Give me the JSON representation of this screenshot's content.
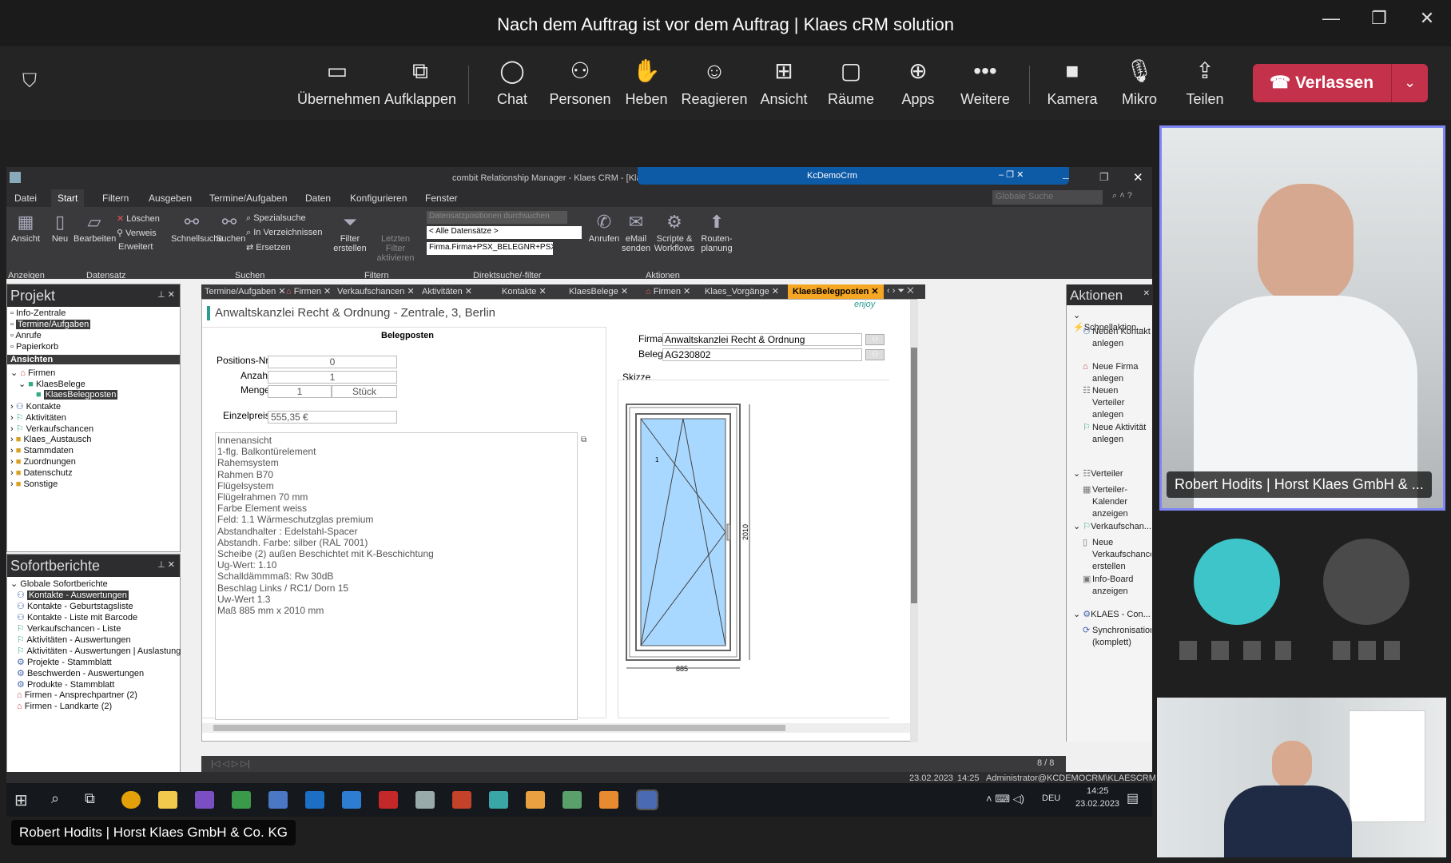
{
  "window": {
    "title": "Nach dem Auftrag ist vor dem Auftrag | Klaes cRM solution",
    "minimize": "—",
    "maximize": "❐",
    "close": "✕"
  },
  "toolbar": {
    "items": [
      {
        "label": "Übernehmen",
        "icon": "share-screen-icon"
      },
      {
        "label": "Aufklappen",
        "icon": "pop-out-icon"
      },
      {
        "label": "Chat",
        "icon": "chat-icon"
      },
      {
        "label": "Personen",
        "icon": "people-icon"
      },
      {
        "label": "Heben",
        "icon": "raise-hand-icon"
      },
      {
        "label": "Reagieren",
        "icon": "react-icon"
      },
      {
        "label": "Ansicht",
        "icon": "view-icon"
      },
      {
        "label": "Räume",
        "icon": "rooms-icon"
      },
      {
        "label": "Apps",
        "icon": "apps-icon"
      },
      {
        "label": "Weitere",
        "icon": "more-icon"
      },
      {
        "label": "Kamera",
        "icon": "camera-icon"
      },
      {
        "label": "Mikro",
        "icon": "mic-icon"
      },
      {
        "label": "Teilen",
        "icon": "share-icon"
      }
    ],
    "leave": "Verlassen"
  },
  "crm": {
    "title": "combit Relationship Manager - Klaes CRM - [Klae",
    "overlay_title": "KcDemoCrm",
    "menu": [
      "Datei",
      "Start",
      "Filtern",
      "Ausgeben",
      "Termine/Aufgaben",
      "Daten",
      "Konfigurieren",
      "Fenster"
    ],
    "search_placeholder": "Globale Suche",
    "ribbon": {
      "ansicht": "Ansicht",
      "neu": "Neu",
      "bearbeiten": "Bearbeiten",
      "loeschen": "Löschen",
      "verweis": "Verweis",
      "erweitert": "Erweitert",
      "schnellsuche": "Schnellsuche",
      "suchen": "Suchen",
      "spezialsuche": "Spezialsuche",
      "in_verzeichnissen": "In Verzeichnissen",
      "ersetzen": "Ersetzen",
      "filter_erstellen": "Filter erstellen",
      "letzten_filter": "Letzten Filter aktivieren",
      "direkt_placeholder": "Datensatzpositionen durchsuchen",
      "alle_datensaetze": "< Alle Datensätze >",
      "firma_field": "Firma.Firma+PSX_BELEGNR+PSX_I",
      "anrufen": "Anrufen",
      "email": "eMail senden",
      "scripte": "Scripte & Workflows",
      "routen": "Routen- planung",
      "groups": [
        "Anzeigen",
        "Datensatz",
        "Suchen",
        "Filtern",
        "Direktsuche/-filter",
        "Aktionen"
      ]
    },
    "projekt": {
      "header": "Projekt",
      "items": [
        "Info-Zentrale",
        "Termine/Aufgaben",
        "Anrufe",
        "Papierkorb"
      ],
      "ansichten": "Ansichten",
      "tree": [
        "Firmen",
        "KlaesBelege",
        "KlaesBelegposten",
        "Kontakte",
        "Aktivitäten",
        "Verkaufschancen",
        "Klaes_Austausch",
        "Stammdaten",
        "Zuordnungen",
        "Datenschutz",
        "Sonstige"
      ]
    },
    "sofort": {
      "header": "Sofortberichte",
      "root": "Globale Sofortberichte",
      "items": [
        "Kontakte - Auswertungen",
        "Kontakte - Geburtstagsliste",
        "Kontakte - Liste mit Barcode",
        "Verkaufschancen - Liste",
        "Aktivitäten - Auswertungen",
        "Aktivitäten - Auswertungen | Auslastung",
        "Projekte - Stammblatt",
        "Beschwerden - Auswertungen",
        "Produkte - Stammblatt",
        "Firmen - Ansprechpartner (2)",
        "Firmen - Landkarte (2)"
      ]
    },
    "tabs": [
      "Termine/Aufgaben",
      "Firmen",
      "Verkaufschancen",
      "Aktivitäten",
      "Kontakte",
      "KlaesBelege",
      "Firmen",
      "Klaes_Vorgänge",
      "KlaesBelegposten"
    ],
    "form": {
      "header": "Anwaltskanzlei Recht & Ordnung - Zentrale, 3, Berlin",
      "section": "Belegposten",
      "pos_label": "Positions-Nr.",
      "pos_value": "0",
      "anzahl_label": "Anzahl",
      "anzahl_value": "1",
      "menge_label": "Menge",
      "menge_value": "1",
      "menge_unit": "Stück",
      "preis_label": "Einzelpreis",
      "preis_value": "555,35 €",
      "notes": [
        "Innenansicht",
        "1-flg. Balkontürelement",
        "Rahemsystem",
        "Rahmen B70",
        "Flügelsystem",
        "Flügelrahmen 70 mm",
        "Farbe Element weiss",
        "Feld: 1.1 Wärmeschutzglas premium",
        "Abstandhalter : Edelstahl-Spacer",
        "Abstandh. Farbe: silber (RAL 7001)",
        "Scheibe (2) außen Beschichtet mit K-Beschichtung",
        "Ug-Wert: 1.10",
        "Schalldämmmaß: Rw 30dB",
        "Beschlag Links / RC1/ Dorn 15",
        "Uw-Wert 1.3",
        "Maß 885 mm x 2010 mm"
      ],
      "firma_label": "Firma",
      "firma_value": "Anwaltskanzlei Recht & Ordnung",
      "beleg_label": "Beleg",
      "beleg_value": "AG230802",
      "skizze_label": "Skizze",
      "dim_width": "885",
      "dim_height": "2010",
      "sash_no": "1",
      "logo": "enjoy"
    },
    "actions": {
      "header": "Aktionen",
      "sections": [
        "Schnellaktion...",
        "Verteiler",
        "Verkaufschan...",
        "KLAES - Con..."
      ],
      "items": [
        "Neuen Kontakt anlegen",
        "Neue Firma anlegen",
        "Neuen Verteiler anlegen",
        "Neue Aktivität anlegen",
        "Verteiler-Kalender anzeigen",
        "Neue Verkaufschance erstellen",
        "Info-Board anzeigen",
        "Synchronisation (komplett)"
      ]
    },
    "nav": "8 / 8",
    "status": {
      "date": "23.02.2023",
      "time": "14:25",
      "user": "Administrator@KCDEMOCRM\\KLAESCRM"
    }
  },
  "taskbar": {
    "lang": "DEU",
    "time": "14:25",
    "date": "23.02.2023",
    "badge": "5"
  },
  "video": {
    "main_name": "Robert Hodits | Horst Klaes GmbH & ...",
    "presenter_name": "Robert Hodits | Horst Klaes GmbH & Co. KG"
  },
  "colors": {
    "leave": "#c4314b",
    "accent": "#7f85f5",
    "tile": "#3ec5c9"
  }
}
